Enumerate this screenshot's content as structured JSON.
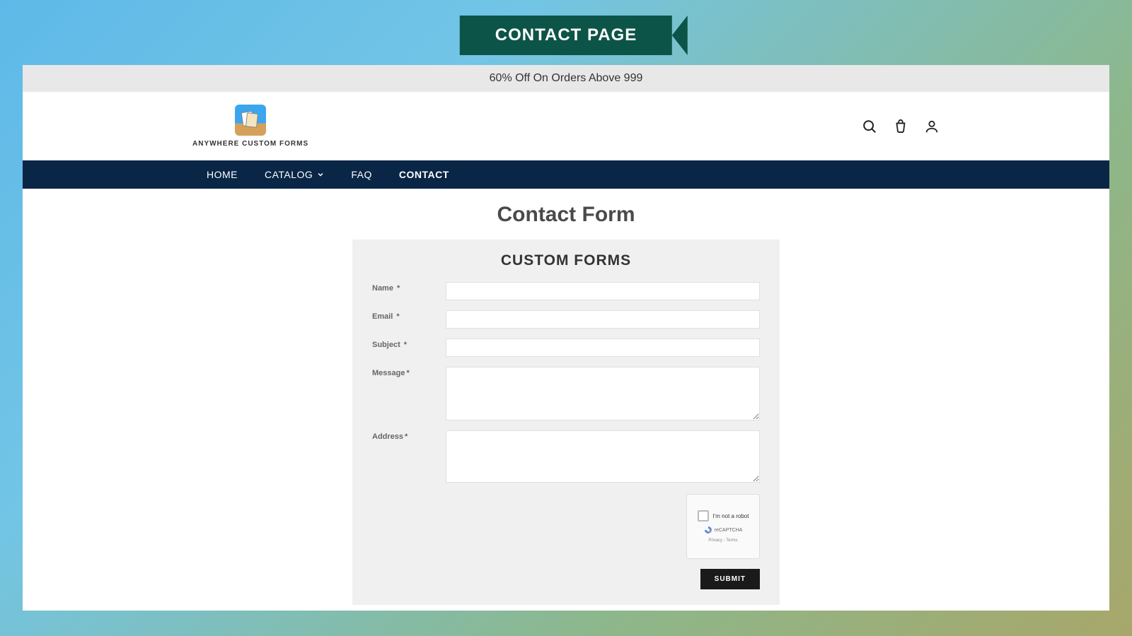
{
  "banner": {
    "title": "CONTACT PAGE"
  },
  "promo": {
    "text": "60% Off On Orders Above 999"
  },
  "logo": {
    "text": "ANYWHERE CUSTOM FORMS"
  },
  "nav": {
    "items": [
      {
        "label": "HOME",
        "has_chevron": false
      },
      {
        "label": "CATALOG",
        "has_chevron": true
      },
      {
        "label": "FAQ",
        "has_chevron": false
      },
      {
        "label": "CONTACT",
        "has_chevron": false
      }
    ]
  },
  "page": {
    "title": "Contact Form"
  },
  "form": {
    "heading": "CUSTOM FORMS",
    "fields": {
      "name": {
        "label": "Name",
        "required": "*",
        "value": ""
      },
      "email": {
        "label": "Email",
        "required": "*",
        "value": ""
      },
      "subject": {
        "label": "Subject",
        "required": "*",
        "value": ""
      },
      "message": {
        "label": "Message",
        "required": "*",
        "value": ""
      },
      "address": {
        "label": "Address",
        "required": "*",
        "value": ""
      }
    },
    "recaptcha": {
      "text": "I'm not a robot",
      "brand": "reCAPTCHA",
      "links": "Privacy - Terms"
    },
    "submit": "SUBMIT"
  }
}
